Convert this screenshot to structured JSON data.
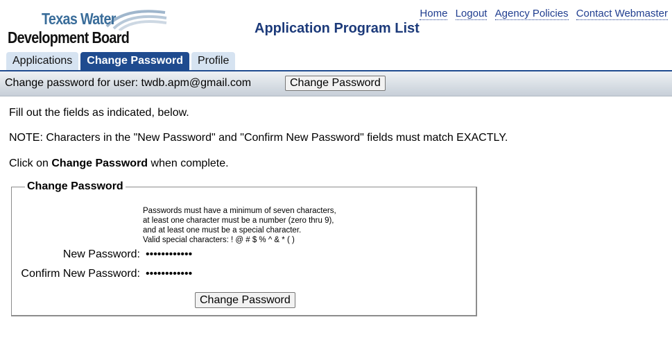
{
  "header": {
    "logo_line1": "Texas Water",
    "logo_line2": "Development Board",
    "page_title": "Application Program List",
    "links": [
      "Home",
      "Logout",
      "Agency Policies",
      "Contact Webmaster"
    ]
  },
  "tabs": [
    {
      "label": "Applications",
      "active": false
    },
    {
      "label": "Change Password",
      "active": true
    },
    {
      "label": "Profile",
      "active": false
    }
  ],
  "userbar": {
    "label": "Change password for user: twdb.apm@gmail.com",
    "button": "Change Password"
  },
  "content": {
    "line1": "Fill out the fields as indicated, below.",
    "line2": "NOTE: Characters in the \"New Password\" and \"Confirm New Password\" fields must match EXACTLY.",
    "line3_pre": "Click on ",
    "line3_bold": "Change Password",
    "line3_post": " when complete."
  },
  "form": {
    "legend": "Change Password",
    "rules": [
      "Passwords must have a minimum of seven characters,",
      "at least one character must be a number (zero thru 9),",
      "and at least one must be a special character.",
      "Valid special characters: ! @ # $ % ^ & * ( )"
    ],
    "new_password_label": "New Password:",
    "new_password_value": "••••••••••••",
    "confirm_password_label": "Confirm New Password:",
    "confirm_password_value": "••••••••••••",
    "submit": "Change Password"
  },
  "colors": {
    "brand_blue": "#1f4b8f",
    "tab_inactive": "#d6e3f1",
    "title_blue": "#1c3a7a",
    "logo_blue": "#3a6d9a"
  }
}
